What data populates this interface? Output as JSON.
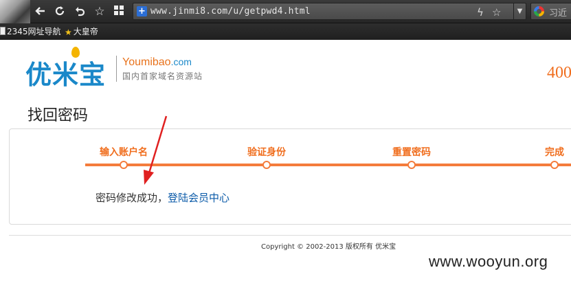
{
  "browser": {
    "url": "www.jinmi8.com/u/getpwd4.html",
    "search_text": "习近",
    "bookmarks": [
      {
        "label": "2345网址导航",
        "icon": "page-icon"
      },
      {
        "label": "大皇帝",
        "icon": "star-icon"
      }
    ]
  },
  "header": {
    "logo_cn": "优米宝",
    "logo_en": "Youmibao",
    "logo_en_domain": ".com",
    "tagline": "国内首家域名资源站",
    "phone": "400"
  },
  "page": {
    "title": "找回密码",
    "steps": [
      {
        "label": "输入账户名"
      },
      {
        "label": "验证身份"
      },
      {
        "label": "重置密码"
      },
      {
        "label": "完成"
      }
    ],
    "message": "密码修改成功，",
    "message_link": "登陆会员中心"
  },
  "footer": {
    "copyright": "Copyright © 2002-2013 版权所有 优米宝"
  },
  "watermark": "www.wooyun.org",
  "colors": {
    "accent": "#f47c3c",
    "brand_blue": "#1a88c9",
    "link": "#0a5aa8"
  }
}
